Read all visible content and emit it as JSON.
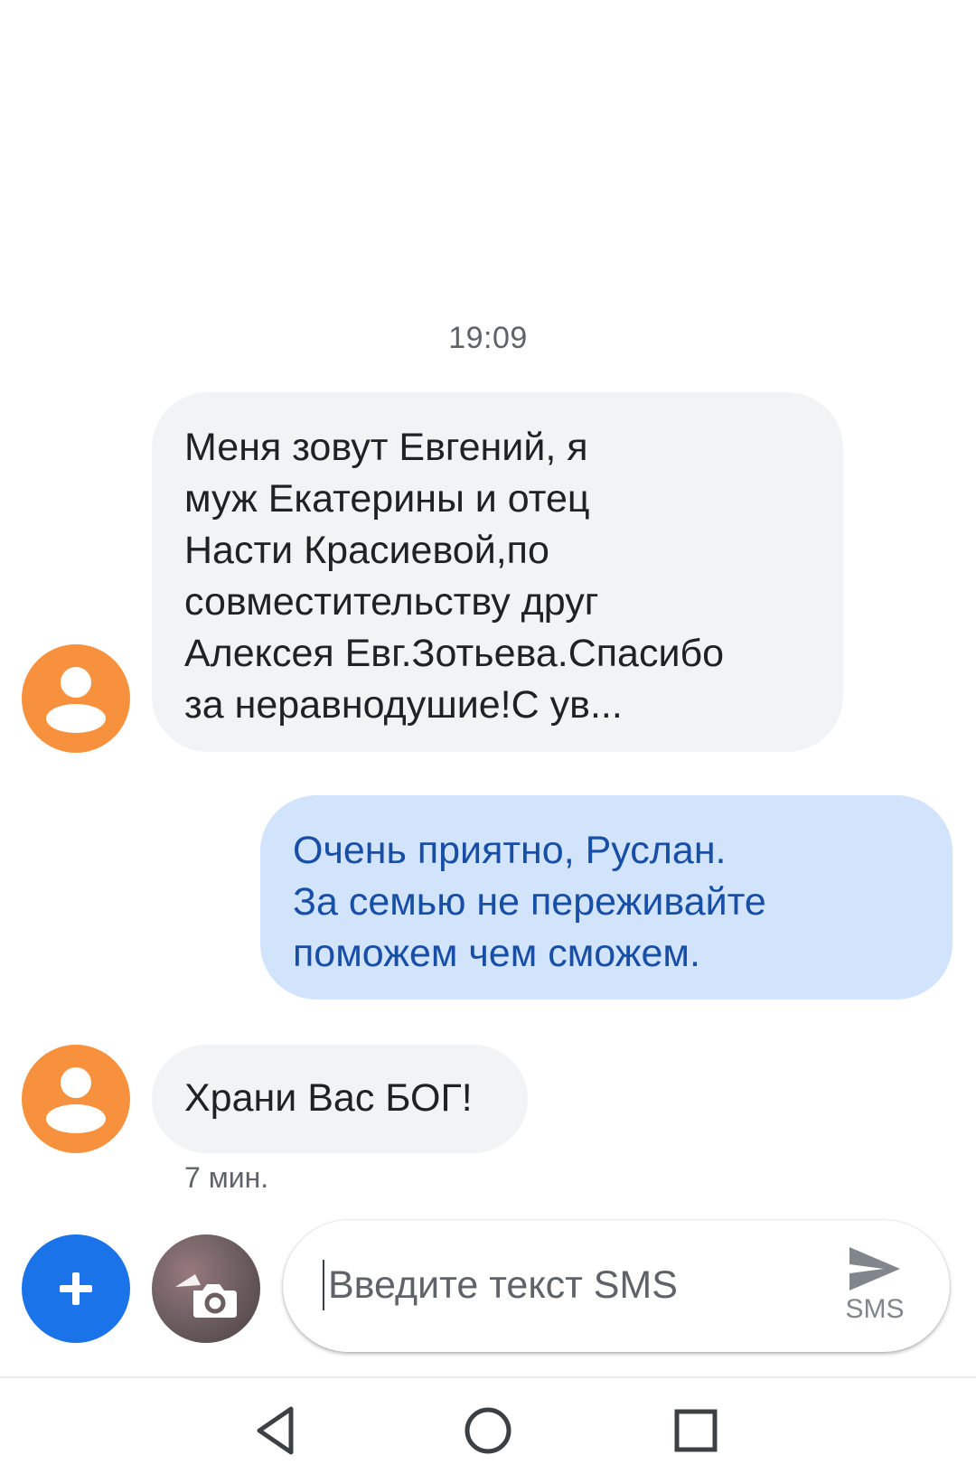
{
  "conversation": {
    "timestamp": "19:09",
    "messages": [
      {
        "direction": "incoming",
        "lines": [
          "Меня зовут Евгений, я",
          "муж Екатерины и отец",
          "Насти Красиевой,по",
          "совместительству друг",
          "Алексея Евг.Зотьева.Спасибо",
          "за неравнодушие!С ув..."
        ]
      },
      {
        "direction": "outgoing",
        "lines": [
          "Очень приятно, Руслан.",
          "За семью не переживайте",
          "поможем чем сможем."
        ]
      },
      {
        "direction": "incoming",
        "lines": [
          "Храни Вас БОГ!"
        ],
        "time": "7 мин."
      }
    ]
  },
  "composer": {
    "placeholder": "Введите текст SMS",
    "value": "",
    "send_label": "SMS"
  },
  "icons": {
    "avatar": "person-icon",
    "attach": "plus-icon",
    "gallery": "camera-icon",
    "send": "send-icon",
    "nav_back": "back-triangle-icon",
    "nav_home": "home-circle-icon",
    "nav_recents": "recents-square-icon"
  },
  "colors": {
    "avatar": "#f8913e",
    "incoming_bubble": "#f1f3f4",
    "outgoing_bubble": "#d2e3fc",
    "outgoing_text": "#174ea6",
    "fab": "#1a73e8"
  }
}
